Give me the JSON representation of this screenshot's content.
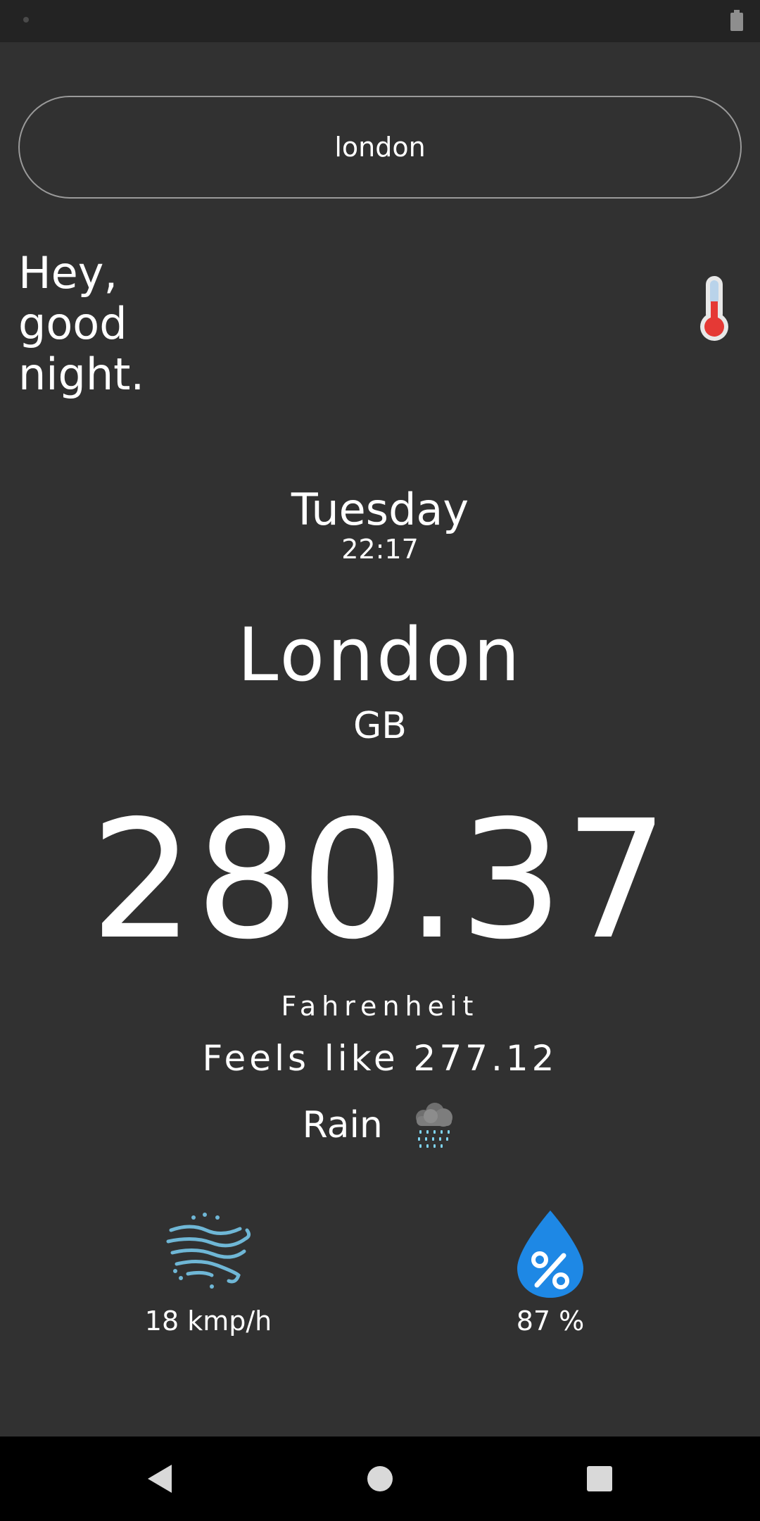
{
  "search": {
    "value": "london"
  },
  "greeting": {
    "line1": "Hey,",
    "line2": "good",
    "line3": "night."
  },
  "weather": {
    "day": "Tuesday",
    "time": "22:17",
    "city": "London",
    "country": "GB",
    "temperature": "280.37",
    "unit": "Fahrenheit",
    "feels_like": "Feels like 277.12",
    "condition": "Rain"
  },
  "stats": {
    "wind": "18 kmp/h",
    "humidity": "87 %"
  },
  "icons": {
    "thermometer": "thermometer-icon",
    "rain": "rain-cloud-icon",
    "wind": "wind-icon",
    "humidity": "humidity-drop-icon"
  },
  "colors": {
    "background": "#313131",
    "status_bar": "#232323",
    "nav_bar": "#000000",
    "text": "#ffffff",
    "humidity_blue": "#1e88e5",
    "wind_blue": "#6fb7d6",
    "thermo_red": "#e53935"
  }
}
